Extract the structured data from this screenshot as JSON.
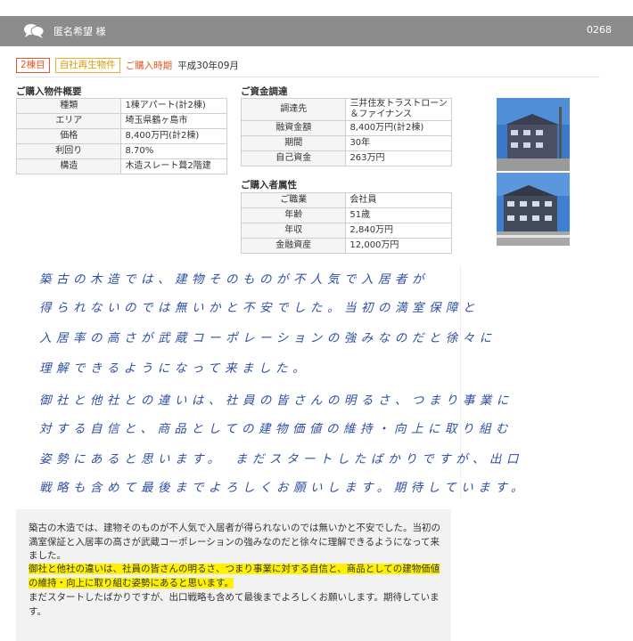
{
  "header": {
    "name": "匿名希望 様",
    "number": "0268"
  },
  "tags": {
    "building": "2棟目",
    "type": "自社再生物件",
    "purchase_label": "ご購入時期",
    "purchase_value": "平成30年09月"
  },
  "property": {
    "title": "ご購入物件概要",
    "rows": [
      {
        "k": "種類",
        "v": "1棟アパート(計2棟)"
      },
      {
        "k": "エリア",
        "v": "埼玉県鶴ヶ島市"
      },
      {
        "k": "価格",
        "v": "8,400万円(計2棟)"
      },
      {
        "k": "利回り",
        "v": "8.70%"
      },
      {
        "k": "構造",
        "v": "木造スレート葺2階建"
      }
    ]
  },
  "funding": {
    "title": "ご資金調達",
    "rows": [
      {
        "k": "調達先",
        "v": "三井住友トラストローン＆ファイナンス"
      },
      {
        "k": "融資金額",
        "v": "8,400万円(計2棟)"
      },
      {
        "k": "期間",
        "v": "30年"
      },
      {
        "k": "自己資金",
        "v": "263万円"
      }
    ]
  },
  "buyer": {
    "title": "ご購入者属性",
    "rows": [
      {
        "k": "ご職業",
        "v": "会社員"
      },
      {
        "k": "年齢",
        "v": "51歳"
      },
      {
        "k": "年収",
        "v": "2,840万円"
      },
      {
        "k": "金融資産",
        "v": "12,000万円"
      }
    ]
  },
  "letter_lines": [
    "築古の木造では、建物そのものが不人気で入居者が",
    "得られないのでは無いかと不安でした。当初の満室保障と",
    "入居率の高さが武蔵コーポレーションの強みなのだと徐々に",
    "理解できるようになって来ました。",
    "御社と他社との違いは、社員の皆さんの明るさ、つまり事業に",
    "対する自信と、商品としての建物価値の維持・向上に取り組む",
    "姿勢にあると思います。　まだスタートしたばかりですが、出口",
    "戦略も含めて最後までよろしくお願いします。期待しています。"
  ],
  "transcript": {
    "p1": "築古の木造では、建物そのものが不人気で入居者が得られないのでは無いかと不安でした。当初の満室保証と入居率の高さが武蔵コーポレーションの強みなのだと徐々に理解できるようになって来ました。",
    "p2": "御社と他社の違いは、社員の皆さんの明るさ、つまり事業に対する自信と、商品としての建物価値の維持・向上に取り組む姿勢にあると思います。",
    "p3": "まだスタートしたばかりですが、出口戦略も含めて最後までよろしくお願いします。期待しています。"
  }
}
